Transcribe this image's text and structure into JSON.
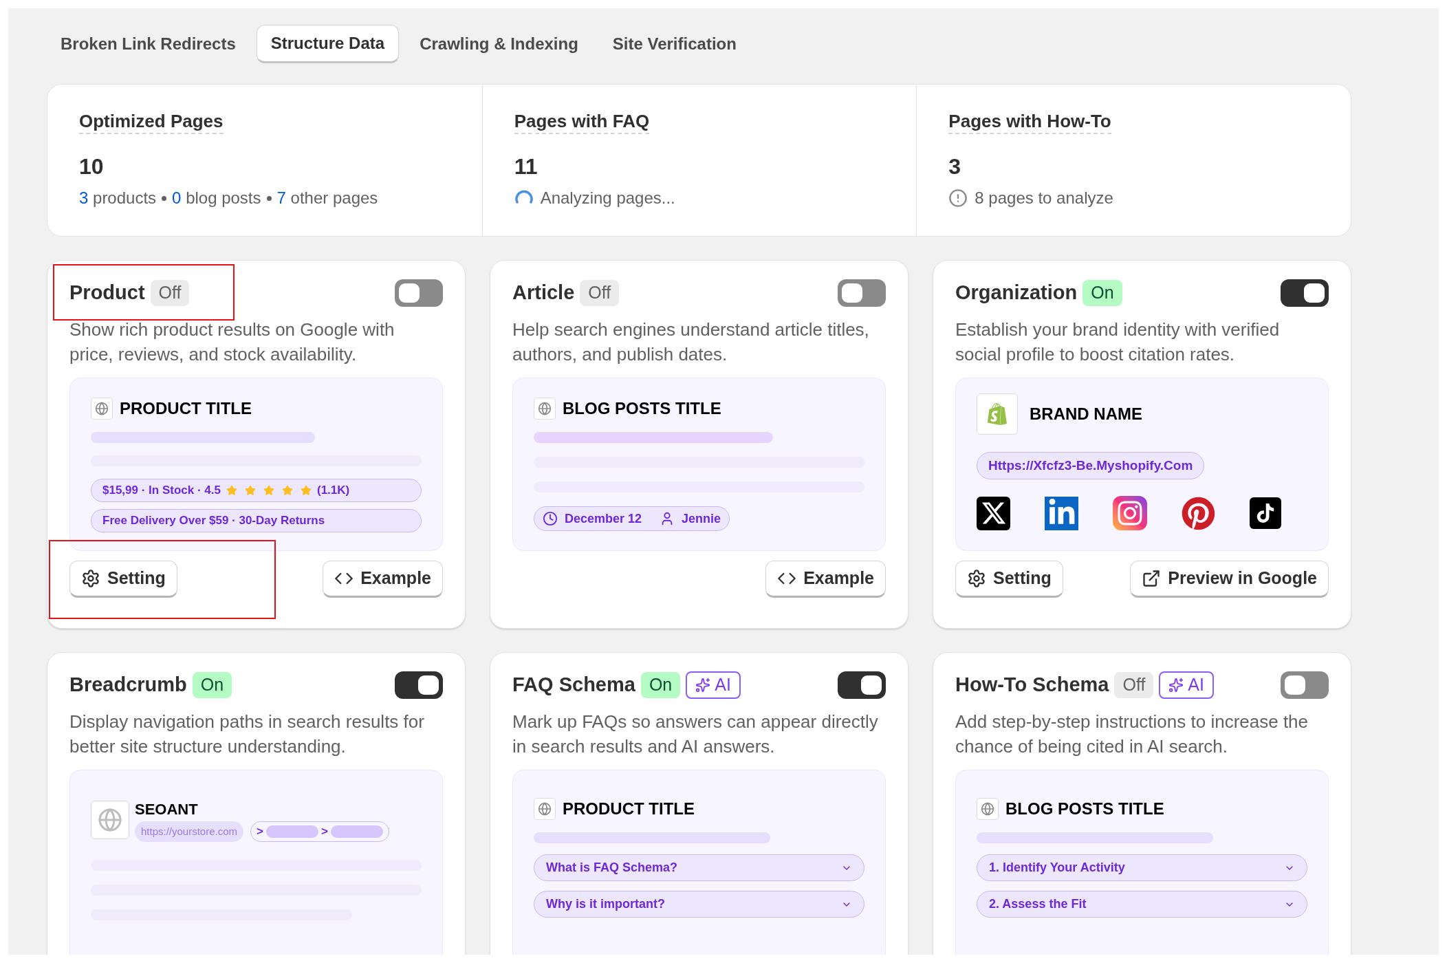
{
  "tabs": [
    {
      "label": "Broken Link Redirects",
      "selected": false
    },
    {
      "label": "Structure Data",
      "selected": true
    },
    {
      "label": "Crawling & Indexing",
      "selected": false
    },
    {
      "label": "Site Verification",
      "selected": false
    }
  ],
  "stats": [
    {
      "title": "Optimized Pages",
      "value": "10",
      "detail": {
        "kind": "breakdown",
        "parts": [
          {
            "count": "3",
            "label": "products"
          },
          {
            "count": "0",
            "label": "blog posts"
          },
          {
            "count": "7",
            "label": "other pages"
          }
        ]
      }
    },
    {
      "title": "Pages with FAQ",
      "value": "11",
      "detail": {
        "kind": "loading",
        "text": "Analyzing pages..."
      }
    },
    {
      "title": "Pages with How-To",
      "value": "3",
      "detail": {
        "kind": "warning",
        "text": "8 pages to analyze"
      }
    }
  ],
  "cards": [
    {
      "title": "Product",
      "title_annotated": true,
      "status": "Off",
      "on": false,
      "description": "Show rich product results on Google with price, reviews, and stock availability.",
      "preview": {
        "kind": "product",
        "title": "PRODUCT TITLE",
        "price_line": "$15,99 · In Stock · 4.5",
        "stars": 5,
        "reviews": "(1.1K)",
        "delivery": "Free Delivery Over $59 · 30-Day Returns"
      },
      "buttons": [
        {
          "kind": "setting",
          "label": "Setting",
          "annotated": true
        },
        {
          "kind": "example",
          "label": "Example"
        }
      ]
    },
    {
      "title": "Article",
      "status": "Off",
      "on": false,
      "description": "Help search engines understand article titles, authors, and publish dates.",
      "preview": {
        "kind": "article",
        "title": "BLOG POSTS TITLE",
        "date": "December 12",
        "author": "Jennie"
      },
      "buttons": [
        {
          "kind": "example",
          "label": "Example"
        }
      ]
    },
    {
      "title": "Organization",
      "status": "On",
      "on": true,
      "description": "Establish your brand identity with verified social profile to boost citation rates.",
      "preview": {
        "kind": "organization",
        "brand": "BRAND NAME",
        "url": "Https://Xfcfz3-Be.Myshopify.Com",
        "socials": [
          {
            "kind": "x"
          },
          {
            "kind": "linkedin"
          },
          {
            "kind": "instagram"
          },
          {
            "kind": "pinterest"
          },
          {
            "kind": "tiktok"
          }
        ]
      },
      "buttons": [
        {
          "kind": "setting",
          "label": "Setting"
        },
        {
          "kind": "preview",
          "label": "Preview in Google"
        }
      ]
    },
    {
      "title": "Breadcrumb",
      "status": "On",
      "on": true,
      "description": "Display navigation paths in search results for better site structure understanding.",
      "preview": {
        "kind": "breadcrumb",
        "site": "SEOANT",
        "url": "https://yourstore.com",
        "separators": [
          ">",
          ">"
        ]
      }
    },
    {
      "title": "FAQ Schema",
      "status": "On",
      "on": true,
      "ai": "AI",
      "description": "Mark up FAQs so answers can appear directly in search results and AI answers.",
      "preview": {
        "kind": "faq",
        "title": "PRODUCT TITLE",
        "items": [
          "What is FAQ Schema?",
          "Why is it important?"
        ]
      }
    },
    {
      "title": "How-To Schema",
      "status": "Off",
      "on": false,
      "ai": "AI",
      "description": "Add step-by-step instructions to increase the chance of being cited in AI search.",
      "preview": {
        "kind": "faq",
        "title": "BLOG POSTS TITLE",
        "items": [
          "1. Identify Your Activity",
          "2. Assess the Fit"
        ]
      }
    }
  ]
}
